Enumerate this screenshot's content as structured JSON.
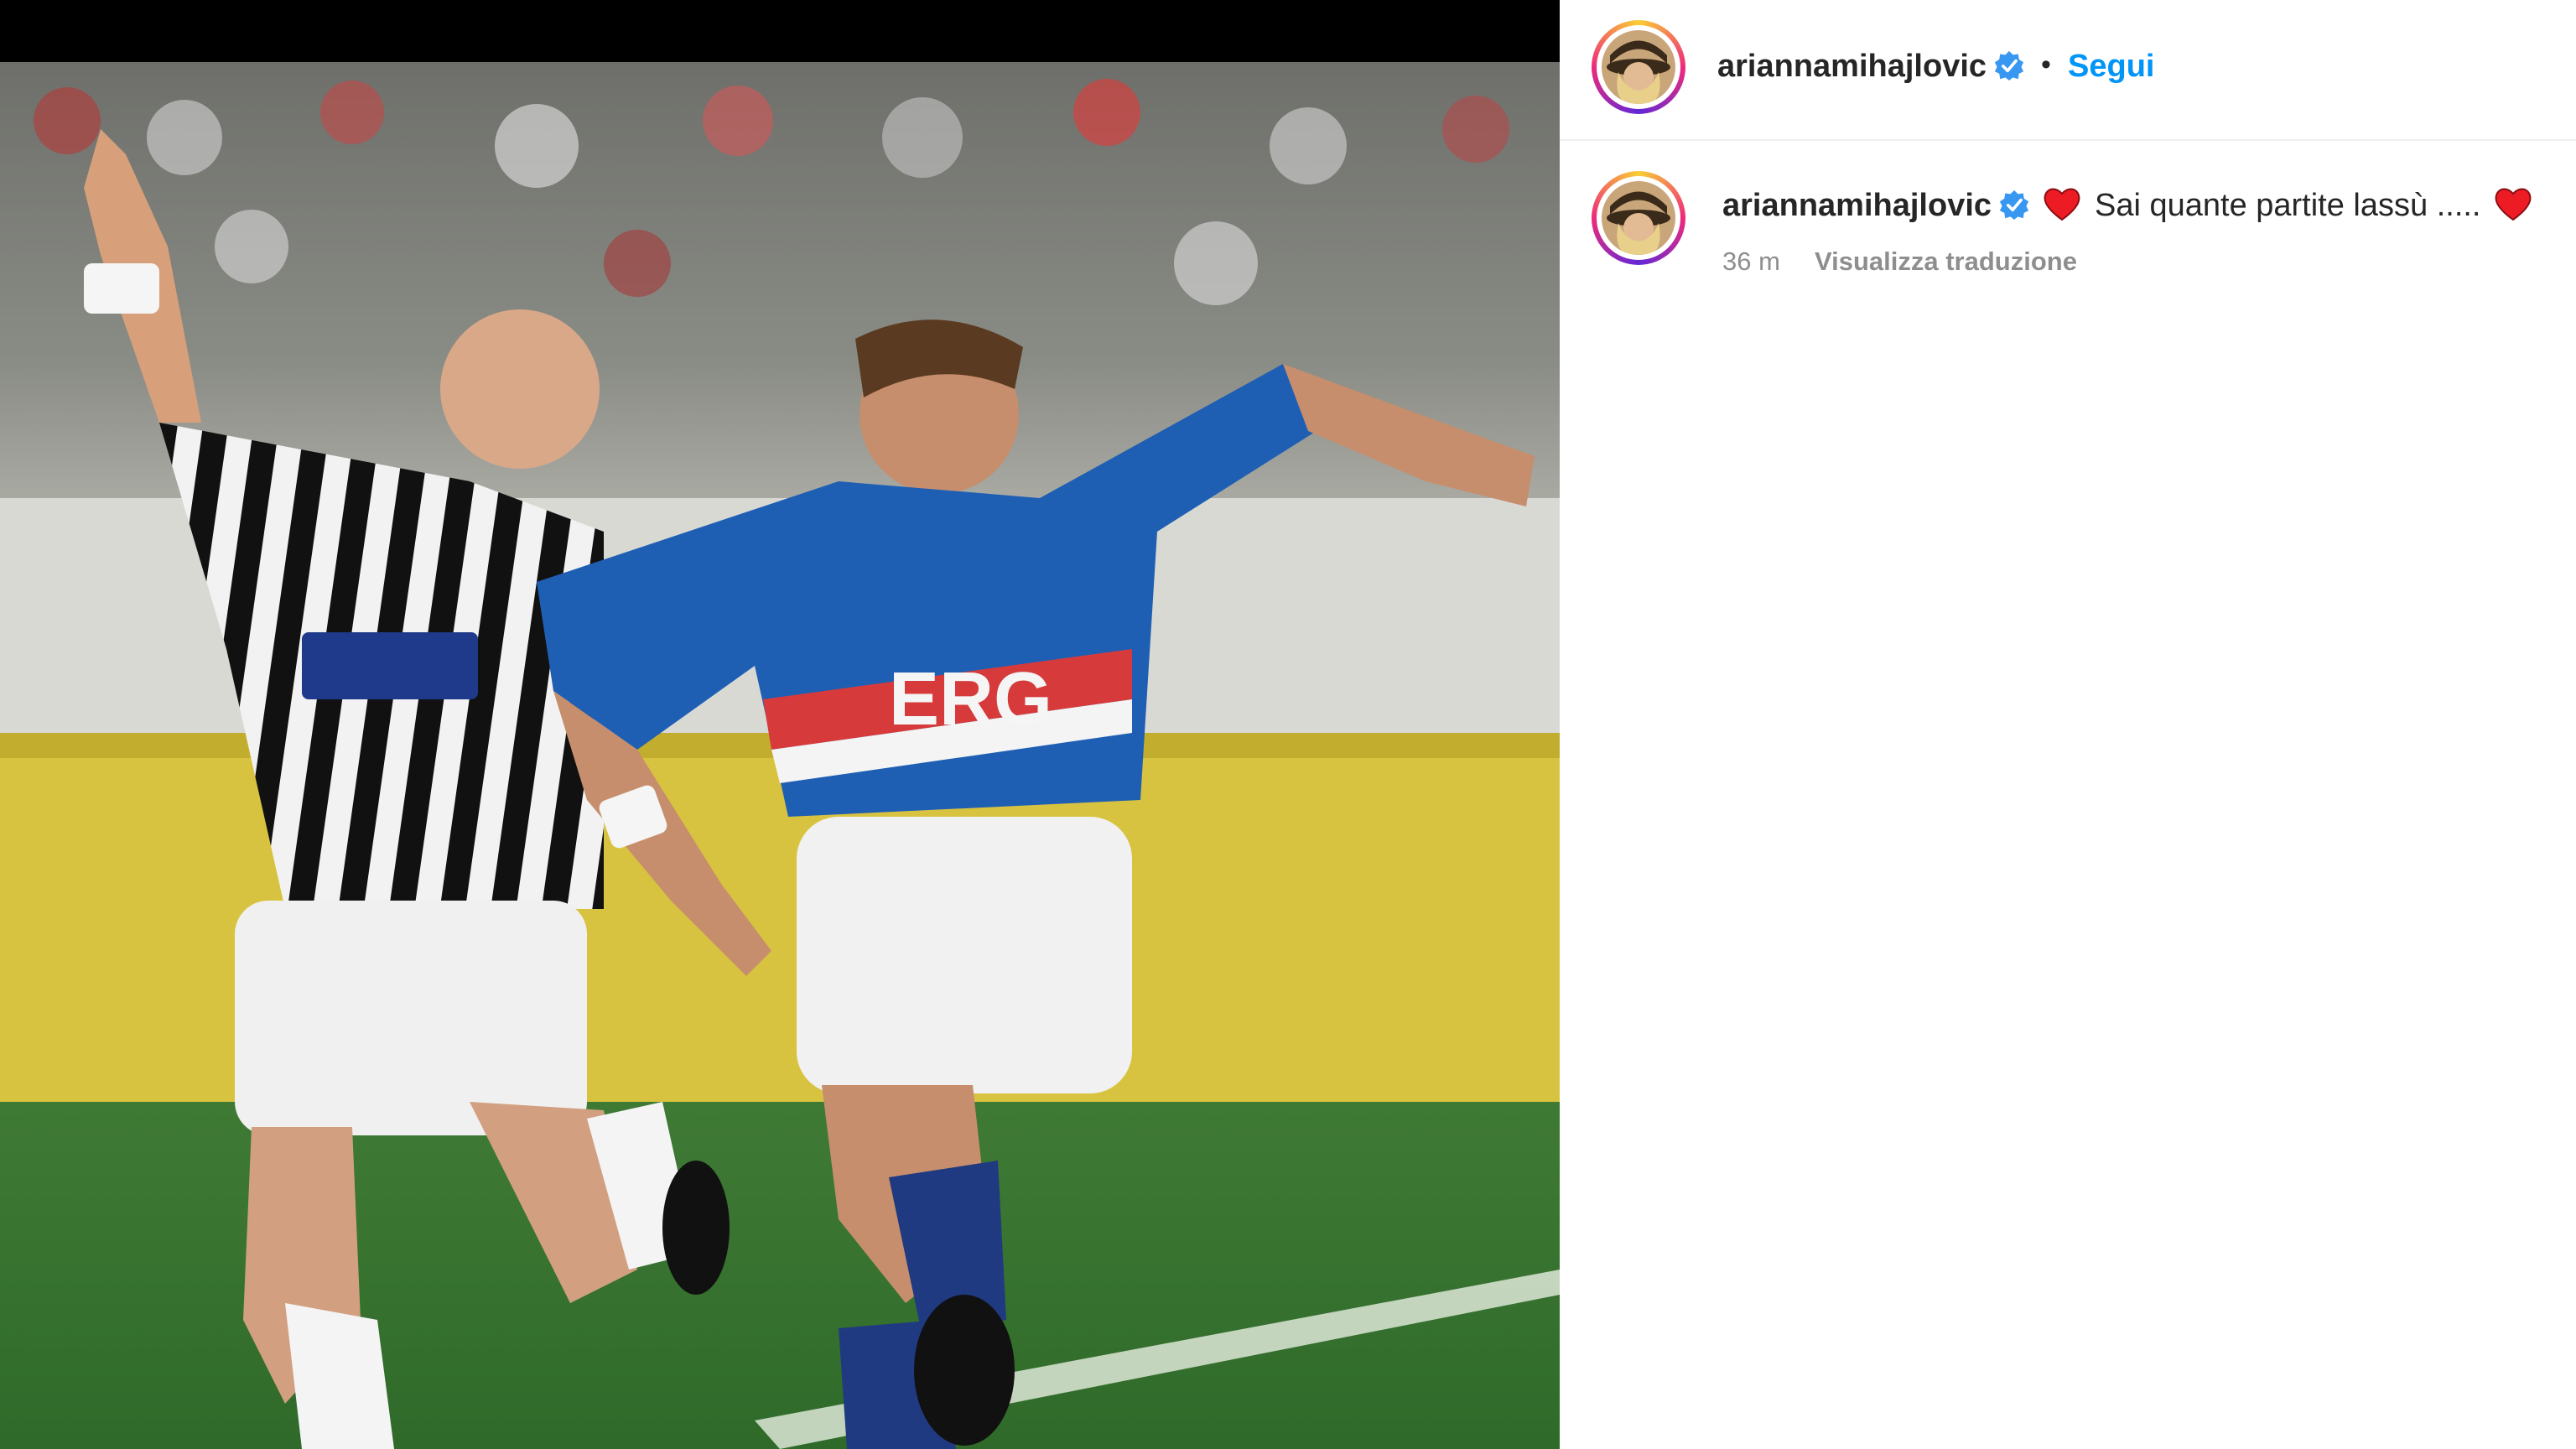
{
  "post": {
    "photo_description_icon": "football-match-photo",
    "header": {
      "username": "ariannamihajlovic",
      "separator": "•",
      "follow_label": "Segui"
    },
    "comment": {
      "username": "ariannamihajlovic",
      "caption": "Sai quante partite lassù .....",
      "time": "36 m",
      "translate_label": "Visualizza traduzione"
    }
  },
  "colors": {
    "follow_blue": "#0095f6",
    "verified_blue": "#3897f0",
    "heart_red": "#ed1c24",
    "text": "#262626",
    "muted": "#8e8e8e"
  }
}
